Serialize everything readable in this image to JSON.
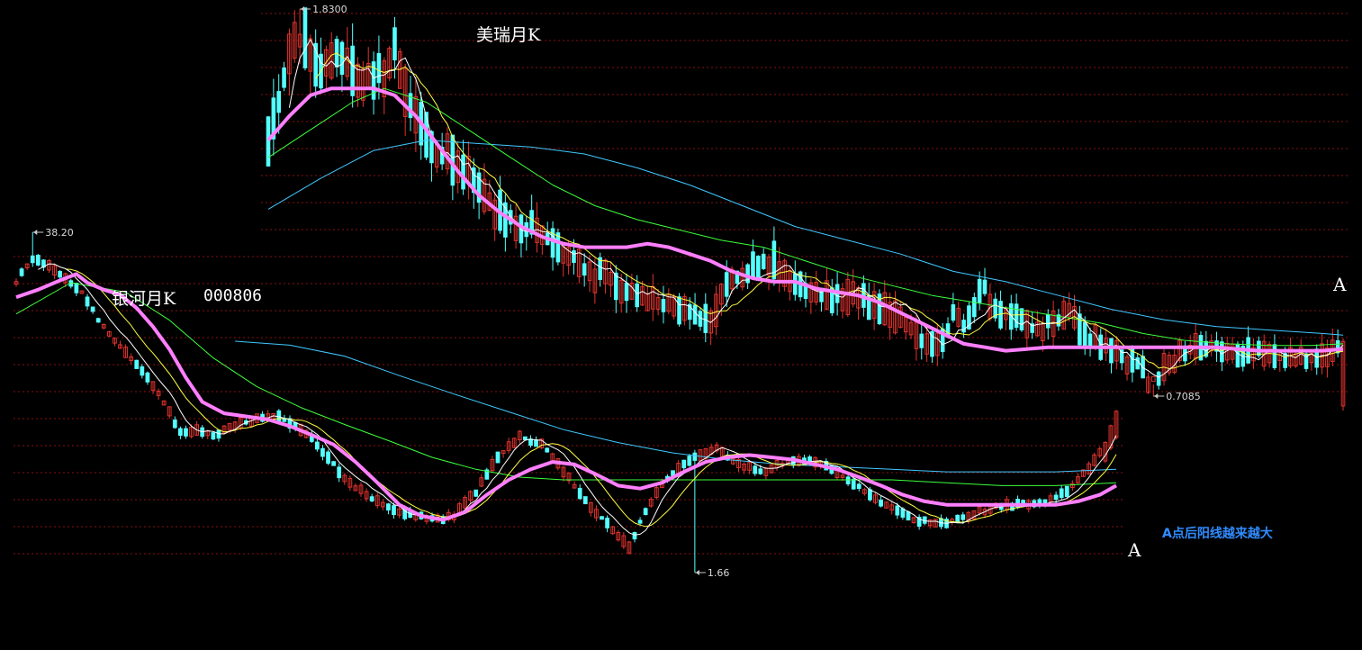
{
  "colors": {
    "background": "#000000",
    "grid": "#8a1010",
    "up_candle": "#e0332e",
    "down_candle": "#54ffff",
    "ma_fast": "#ffffff",
    "ma_mid": "#ffff40",
    "ma_pink": "#ff7fff",
    "ma_green": "#3cff3c",
    "ma_long": "#40c8ff",
    "annotation": "#2f8cff"
  },
  "annotations": {
    "meirui_title": "美瑞月K",
    "yinhe_title": "银河月K",
    "yinhe_code": "000806",
    "mark_top": "A",
    "mark_bottom": "A",
    "note": "A点后阳线越来越大"
  },
  "chart_data": [
    {
      "type": "candlestick",
      "name": "美瑞月K",
      "grid": true,
      "price_labels": {
        "high": "1.8300",
        "low": "0.7085"
      },
      "high": 1.83,
      "low": 0.7085,
      "shape": [
        [
          0,
          1.45
        ],
        [
          3,
          1.62
        ],
        [
          6,
          1.78
        ],
        [
          10,
          1.64
        ],
        [
          14,
          1.7
        ],
        [
          18,
          1.62
        ],
        [
          22,
          1.64
        ],
        [
          24,
          1.7
        ],
        [
          26,
          1.58
        ],
        [
          28,
          1.52
        ],
        [
          32,
          1.42
        ],
        [
          36,
          1.38
        ],
        [
          40,
          1.3
        ],
        [
          44,
          1.24
        ],
        [
          48,
          1.2
        ],
        [
          52,
          1.18
        ],
        [
          56,
          1.14
        ],
        [
          60,
          1.08
        ],
        [
          64,
          1.05
        ],
        [
          68,
          1.02
        ],
        [
          72,
          0.99
        ],
        [
          76,
          0.97
        ],
        [
          80,
          0.94
        ],
        [
          84,
          0.92
        ],
        [
          86,
          1.0
        ],
        [
          88,
          1.05
        ],
        [
          92,
          1.08
        ],
        [
          96,
          1.1
        ],
        [
          100,
          1.02
        ],
        [
          104,
          1.0
        ],
        [
          108,
          1.0
        ],
        [
          112,
          0.99
        ],
        [
          116,
          0.97
        ],
        [
          120,
          0.93
        ],
        [
          124,
          0.88
        ],
        [
          128,
          0.86
        ],
        [
          130,
          0.94
        ],
        [
          132,
          0.92
        ],
        [
          134,
          0.97
        ],
        [
          136,
          1.02
        ],
        [
          138,
          0.95
        ],
        [
          142,
          0.93
        ],
        [
          146,
          0.9
        ],
        [
          150,
          0.93
        ],
        [
          152,
          0.95
        ],
        [
          154,
          0.9
        ],
        [
          158,
          0.86
        ],
        [
          162,
          0.82
        ],
        [
          166,
          0.79
        ],
        [
          168,
          0.72
        ],
        [
          170,
          0.79
        ],
        [
          172,
          0.82
        ],
        [
          176,
          0.85
        ],
        [
          180,
          0.86
        ],
        [
          184,
          0.83
        ],
        [
          188,
          0.84
        ],
        [
          192,
          0.82
        ],
        [
          196,
          0.81
        ],
        [
          200,
          0.82
        ],
        [
          204,
          0.85
        ]
      ],
      "ma_pink": [
        [
          0,
          1.45
        ],
        [
          4,
          1.52
        ],
        [
          8,
          1.58
        ],
        [
          12,
          1.6
        ],
        [
          16,
          1.6
        ],
        [
          20,
          1.6
        ],
        [
          24,
          1.58
        ],
        [
          28,
          1.52
        ],
        [
          32,
          1.44
        ],
        [
          36,
          1.36
        ],
        [
          40,
          1.29
        ],
        [
          44,
          1.24
        ],
        [
          48,
          1.2
        ],
        [
          52,
          1.17
        ],
        [
          56,
          1.15
        ],
        [
          60,
          1.14
        ],
        [
          64,
          1.14
        ],
        [
          68,
          1.14
        ],
        [
          72,
          1.15
        ],
        [
          76,
          1.14
        ],
        [
          80,
          1.12
        ],
        [
          84,
          1.1
        ],
        [
          88,
          1.07
        ],
        [
          92,
          1.05
        ],
        [
          96,
          1.04
        ],
        [
          100,
          1.04
        ],
        [
          104,
          1.02
        ],
        [
          108,
          1.01
        ],
        [
          112,
          1.0
        ],
        [
          116,
          0.98
        ],
        [
          120,
          0.95
        ],
        [
          124,
          0.92
        ],
        [
          128,
          0.89
        ],
        [
          132,
          0.86
        ],
        [
          136,
          0.85
        ],
        [
          140,
          0.84
        ],
        [
          144,
          0.845
        ],
        [
          148,
          0.85
        ],
        [
          152,
          0.85
        ],
        [
          156,
          0.85
        ],
        [
          160,
          0.85
        ],
        [
          164,
          0.85
        ],
        [
          168,
          0.85
        ],
        [
          172,
          0.85
        ],
        [
          176,
          0.85
        ],
        [
          180,
          0.85
        ],
        [
          184,
          0.845
        ],
        [
          188,
          0.84
        ],
        [
          192,
          0.84
        ],
        [
          196,
          0.84
        ],
        [
          200,
          0.84
        ],
        [
          204,
          0.845
        ]
      ],
      "ma_green": [
        [
          0,
          1.4
        ],
        [
          8,
          1.48
        ],
        [
          16,
          1.56
        ],
        [
          22,
          1.6
        ],
        [
          30,
          1.56
        ],
        [
          38,
          1.48
        ],
        [
          46,
          1.4
        ],
        [
          54,
          1.32
        ],
        [
          62,
          1.26
        ],
        [
          70,
          1.22
        ],
        [
          78,
          1.19
        ],
        [
          86,
          1.16
        ],
        [
          94,
          1.14
        ],
        [
          102,
          1.1
        ],
        [
          110,
          1.06
        ],
        [
          118,
          1.03
        ],
        [
          126,
          1.0
        ],
        [
          134,
          0.98
        ],
        [
          142,
          0.96
        ],
        [
          150,
          0.94
        ],
        [
          158,
          0.92
        ],
        [
          166,
          0.89
        ],
        [
          174,
          0.87
        ],
        [
          182,
          0.86
        ],
        [
          190,
          0.855
        ],
        [
          198,
          0.855
        ],
        [
          204,
          0.86
        ]
      ],
      "ma_long": [
        [
          0,
          1.25
        ],
        [
          10,
          1.34
        ],
        [
          20,
          1.42
        ],
        [
          30,
          1.45
        ],
        [
          40,
          1.44
        ],
        [
          50,
          1.43
        ],
        [
          60,
          1.41
        ],
        [
          70,
          1.37
        ],
        [
          80,
          1.32
        ],
        [
          90,
          1.26
        ],
        [
          100,
          1.2
        ],
        [
          110,
          1.16
        ],
        [
          120,
          1.12
        ],
        [
          130,
          1.07
        ],
        [
          140,
          1.04
        ],
        [
          150,
          1.0
        ],
        [
          160,
          0.96
        ],
        [
          170,
          0.93
        ],
        [
          180,
          0.91
        ],
        [
          190,
          0.9
        ],
        [
          200,
          0.89
        ],
        [
          204,
          0.885
        ]
      ]
    },
    {
      "type": "candlestick",
      "name": "银河月K 000806",
      "grid": true,
      "price_labels": {
        "high": "38.20",
        "low": "1.66"
      },
      "high": 38.2,
      "low": 1.66,
      "shape": [
        [
          0,
          24
        ],
        [
          3,
          30
        ],
        [
          6,
          28
        ],
        [
          9,
          25
        ],
        [
          12,
          22
        ],
        [
          15,
          17
        ],
        [
          18,
          14
        ],
        [
          21,
          12
        ],
        [
          24,
          10
        ],
        [
          27,
          8
        ],
        [
          30,
          6
        ],
        [
          33,
          6.2
        ],
        [
          36,
          5.8
        ],
        [
          40,
          6.5
        ],
        [
          44,
          6.8
        ],
        [
          48,
          7
        ],
        [
          52,
          6.2
        ],
        [
          56,
          5.1
        ],
        [
          60,
          3.9
        ],
        [
          64,
          3.4
        ],
        [
          68,
          3.0
        ],
        [
          72,
          2.8
        ],
        [
          76,
          2.7
        ],
        [
          80,
          2.8
        ],
        [
          84,
          3.5
        ],
        [
          88,
          4.8
        ],
        [
          92,
          5.8
        ],
        [
          96,
          5.4
        ],
        [
          100,
          4.2
        ],
        [
          104,
          3.2
        ],
        [
          108,
          2.6
        ],
        [
          112,
          2.1
        ],
        [
          116,
          3.2
        ],
        [
          120,
          4.2
        ],
        [
          124,
          4.8
        ],
        [
          128,
          5.2
        ],
        [
          132,
          4.5
        ],
        [
          136,
          4.2
        ],
        [
          140,
          4.5
        ],
        [
          144,
          4.7
        ],
        [
          148,
          4.4
        ],
        [
          152,
          3.9
        ],
        [
          156,
          3.4
        ],
        [
          160,
          3.0
        ],
        [
          164,
          2.7
        ],
        [
          168,
          2.6
        ],
        [
          172,
          2.7
        ],
        [
          176,
          2.9
        ],
        [
          180,
          3.1
        ],
        [
          184,
          3.1
        ],
        [
          188,
          3.2
        ],
        [
          192,
          3.5
        ],
        [
          196,
          4.3
        ],
        [
          199,
          5.4
        ],
        [
          201,
          7.2
        ]
      ],
      "ma_pink": [
        [
          0,
          21
        ],
        [
          4,
          22.5
        ],
        [
          8,
          24.5
        ],
        [
          11,
          26
        ],
        [
          13,
          24
        ],
        [
          16,
          22.5
        ],
        [
          19,
          21.5
        ],
        [
          22,
          19
        ],
        [
          25,
          16
        ],
        [
          28,
          13
        ],
        [
          31,
          10
        ],
        [
          34,
          8
        ],
        [
          38,
          7.2
        ],
        [
          42,
          7
        ],
        [
          46,
          6.8
        ],
        [
          50,
          6.4
        ],
        [
          54,
          5.9
        ],
        [
          58,
          5.4
        ],
        [
          62,
          4.6
        ],
        [
          66,
          3.8
        ],
        [
          70,
          3.1
        ],
        [
          74,
          2.8
        ],
        [
          78,
          2.7
        ],
        [
          82,
          2.9
        ],
        [
          86,
          3.4
        ],
        [
          90,
          3.9
        ],
        [
          94,
          4.3
        ],
        [
          98,
          4.6
        ],
        [
          102,
          4.5
        ],
        [
          106,
          4.1
        ],
        [
          110,
          3.7
        ],
        [
          114,
          3.6
        ],
        [
          118,
          3.8
        ],
        [
          122,
          4.2
        ],
        [
          126,
          4.6
        ],
        [
          130,
          4.8
        ],
        [
          134,
          4.9
        ],
        [
          138,
          4.8
        ],
        [
          142,
          4.7
        ],
        [
          146,
          4.5
        ],
        [
          150,
          4.3
        ],
        [
          154,
          4.0
        ],
        [
          158,
          3.7
        ],
        [
          162,
          3.4
        ],
        [
          166,
          3.2
        ],
        [
          170,
          3.1
        ],
        [
          174,
          3.1
        ],
        [
          178,
          3.1
        ],
        [
          182,
          3.1
        ],
        [
          186,
          3.1
        ],
        [
          190,
          3.1
        ],
        [
          194,
          3.2
        ],
        [
          198,
          3.4
        ],
        [
          201,
          3.7
        ]
      ],
      "ma_green": [
        [
          0,
          18
        ],
        [
          10,
          24
        ],
        [
          20,
          22
        ],
        [
          28,
          17
        ],
        [
          36,
          12
        ],
        [
          44,
          9.2
        ],
        [
          52,
          7.6
        ],
        [
          60,
          6.5
        ],
        [
          68,
          5.6
        ],
        [
          76,
          4.8
        ],
        [
          84,
          4.3
        ],
        [
          92,
          4.0
        ],
        [
          100,
          3.9
        ],
        [
          110,
          3.9
        ],
        [
          120,
          3.9
        ],
        [
          130,
          3.9
        ],
        [
          140,
          3.9
        ],
        [
          150,
          3.9
        ],
        [
          160,
          3.9
        ],
        [
          170,
          3.8
        ],
        [
          180,
          3.7
        ],
        [
          190,
          3.7
        ],
        [
          201,
          3.8
        ]
      ],
      "ma_long": [
        [
          40,
          14
        ],
        [
          50,
          13.5
        ],
        [
          60,
          12.2
        ],
        [
          70,
          10.2
        ],
        [
          80,
          8.6
        ],
        [
          90,
          7.3
        ],
        [
          100,
          6.2
        ],
        [
          110,
          5.5
        ],
        [
          120,
          5.0
        ],
        [
          130,
          4.7
        ],
        [
          140,
          4.5
        ],
        [
          150,
          4.4
        ],
        [
          160,
          4.3
        ],
        [
          170,
          4.2
        ],
        [
          180,
          4.2
        ],
        [
          190,
          4.2
        ],
        [
          201,
          4.3
        ]
      ]
    }
  ]
}
